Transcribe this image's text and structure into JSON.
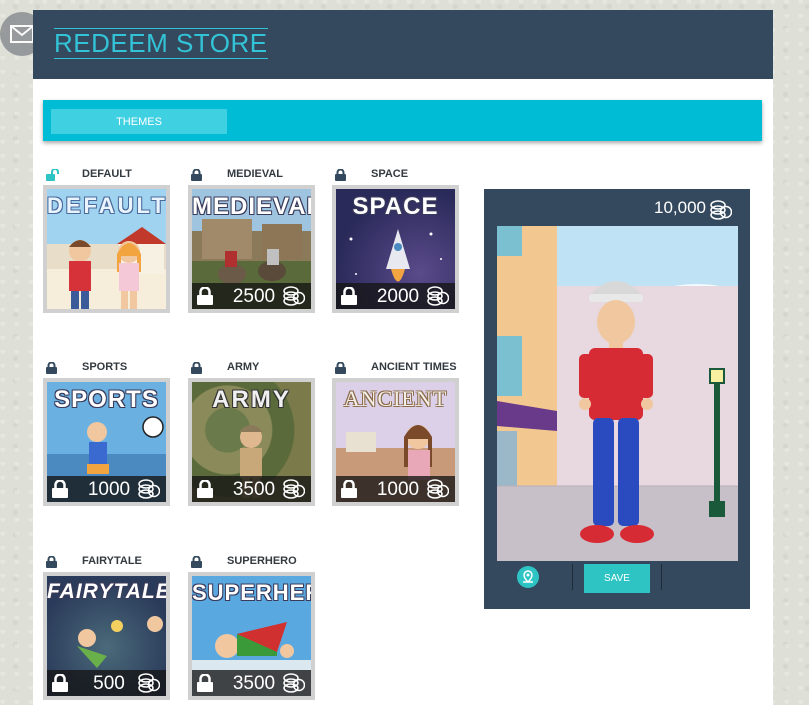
{
  "store": {
    "title": "REDEEM STORE",
    "tab_label": "THEMES"
  },
  "themes": [
    {
      "name": "DEFAULT",
      "art_title": "DEFAULT",
      "locked": false,
      "price": null
    },
    {
      "name": "MEDIEVAL",
      "art_title": "MEDIEVAL",
      "locked": true,
      "price": "2500"
    },
    {
      "name": "SPACE",
      "art_title": "SPACE",
      "locked": true,
      "price": "2000"
    },
    {
      "name": "SPORTS",
      "art_title": "SPORTS",
      "locked": true,
      "price": "1000"
    },
    {
      "name": "ARMY",
      "art_title": "ARMY",
      "locked": true,
      "price": "3500"
    },
    {
      "name": "ANCIENT TIMES",
      "art_title": "ANCIENT",
      "locked": true,
      "price": "1000"
    },
    {
      "name": "FAIRYTALE",
      "art_title": "FAIRYTALE",
      "locked": true,
      "price": "500"
    },
    {
      "name": "SUPERHERO",
      "art_title": "SUPERHERO",
      "locked": true,
      "price": "3500"
    }
  ],
  "avatar": {
    "balance": "10,000",
    "save_label": "SAVE"
  },
  "colors": {
    "header_bg": "#34495e",
    "accent": "#00bcd4",
    "title_text": "#33c3d6",
    "button": "#2ec4c4"
  },
  "icons": {
    "lock": "padlock-closed",
    "unlock": "padlock-open",
    "coin": "coin-stack",
    "location": "map-pin"
  }
}
